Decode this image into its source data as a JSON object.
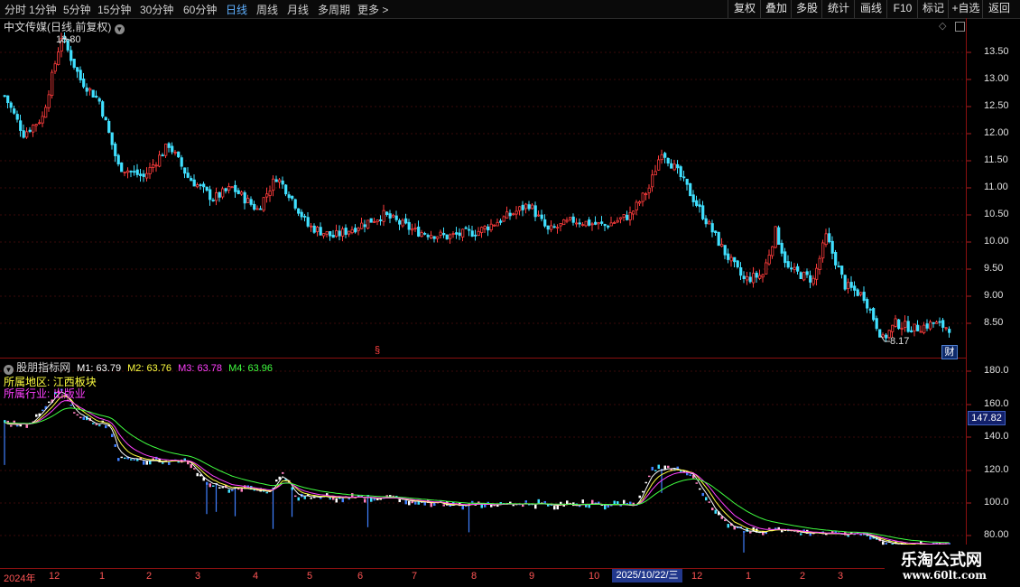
{
  "toolbar": {
    "periods": [
      {
        "label": "分时",
        "x": 5
      },
      {
        "label": "1分钟",
        "x": 32
      },
      {
        "label": "5分钟",
        "x": 70
      },
      {
        "label": "15分钟",
        "x": 108
      },
      {
        "label": "30分钟",
        "x": 155
      },
      {
        "label": "60分钟",
        "x": 203
      },
      {
        "label": "日线",
        "x": 250,
        "active": true
      },
      {
        "label": "周线",
        "x": 284
      },
      {
        "label": "月线",
        "x": 318
      },
      {
        "label": "多周期",
        "x": 352
      },
      {
        "label": "更多 >",
        "x": 396
      }
    ],
    "tools": [
      {
        "label": "复权",
        "x": 806,
        "w": 36
      },
      {
        "label": "叠加",
        "x": 842,
        "w": 34
      },
      {
        "label": "多股",
        "x": 876,
        "w": 34
      },
      {
        "label": "统计",
        "x": 910,
        "w": 36
      },
      {
        "label": "画线",
        "x": 946,
        "w": 36
      },
      {
        "label": "F10",
        "x": 982,
        "w": 34
      },
      {
        "label": "标记",
        "x": 1016,
        "w": 34
      },
      {
        "label": "+自选",
        "x": 1050,
        "w": 38
      },
      {
        "label": "返回",
        "x": 1088,
        "w": 36
      }
    ]
  },
  "main_chart": {
    "title": "中文传媒(日线,前复权)",
    "high_label": "13.80",
    "low_label": "8.17",
    "cai_badge": "财",
    "y_ticks": [
      "13.50",
      "13.00",
      "12.50",
      "12.00",
      "11.50",
      "11.00",
      "10.50",
      "10.00",
      "9.50",
      "9.00",
      "8.50"
    ]
  },
  "indicator": {
    "name": "股朋指标网",
    "m1": "M1: 63.79",
    "m2": "M2: 63.76",
    "m3": "M3: 63.78",
    "m4": "M4: 63.96",
    "region_label": "所属地区:",
    "region_value": "江西板块",
    "industry_label": "所属行业:",
    "industry_value": "出版业",
    "y_ticks": [
      "180.0",
      "160.0",
      "140.0",
      "120.0",
      "100.0",
      "80.00"
    ],
    "price_tag": "147.82"
  },
  "time_axis": {
    "labels": [
      "2024年",
      "12",
      "1",
      "2",
      "3",
      "4",
      "5",
      "6",
      "7",
      "8",
      "9",
      "10",
      "12",
      "1",
      "2",
      "3"
    ],
    "cursor_date": "2025/10/22/三"
  },
  "watermark": {
    "title": "乐淘公式网",
    "url": "www.60lt.com"
  },
  "chart_data": {
    "type": "candlestick",
    "price_range": [
      8.0,
      13.9
    ],
    "close_anchors": [
      [
        0,
        12.7
      ],
      [
        6,
        12.0
      ],
      [
        12,
        12.3
      ],
      [
        18,
        13.8
      ],
      [
        24,
        13.0
      ],
      [
        30,
        12.6
      ],
      [
        36,
        11.4
      ],
      [
        44,
        11.2
      ],
      [
        52,
        11.8
      ],
      [
        58,
        11.2
      ],
      [
        66,
        10.8
      ],
      [
        72,
        11.0
      ],
      [
        80,
        10.6
      ],
      [
        86,
        11.2
      ],
      [
        90,
        10.9
      ],
      [
        96,
        10.3
      ],
      [
        104,
        10.1
      ],
      [
        112,
        10.3
      ],
      [
        120,
        10.5
      ],
      [
        130,
        10.2
      ],
      [
        140,
        10.1
      ],
      [
        150,
        10.2
      ],
      [
        160,
        10.5
      ],
      [
        166,
        10.7
      ],
      [
        172,
        10.2
      ],
      [
        180,
        10.4
      ],
      [
        190,
        10.3
      ],
      [
        198,
        10.5
      ],
      [
        204,
        11.0
      ],
      [
        208,
        11.7
      ],
      [
        214,
        11.2
      ],
      [
        220,
        10.6
      ],
      [
        228,
        9.8
      ],
      [
        234,
        9.3
      ],
      [
        240,
        9.4
      ],
      [
        244,
        10.2
      ],
      [
        248,
        9.5
      ],
      [
        256,
        9.3
      ],
      [
        260,
        10.1
      ],
      [
        266,
        9.2
      ],
      [
        272,
        9.0
      ],
      [
        278,
        8.2
      ],
      [
        282,
        8.5
      ],
      [
        288,
        8.4
      ],
      [
        294,
        8.5
      ],
      [
        300,
        8.4
      ]
    ],
    "indicator_range": [
      75,
      185
    ],
    "indicator_anchors": [
      [
        0,
        148
      ],
      [
        8,
        148
      ],
      [
        18,
        170
      ],
      [
        22,
        155
      ],
      [
        28,
        148
      ],
      [
        33,
        148
      ],
      [
        36,
        128
      ],
      [
        50,
        125
      ],
      [
        58,
        125
      ],
      [
        64,
        112
      ],
      [
        70,
        109
      ],
      [
        76,
        108
      ],
      [
        84,
        107
      ],
      [
        88,
        118
      ],
      [
        92,
        104
      ],
      [
        110,
        103
      ],
      [
        120,
        103
      ],
      [
        130,
        101
      ],
      [
        140,
        99
      ],
      [
        150,
        99
      ],
      [
        160,
        99
      ],
      [
        170,
        99
      ],
      [
        190,
        99
      ],
      [
        200,
        99
      ],
      [
        205,
        120
      ],
      [
        212,
        121
      ],
      [
        218,
        116
      ],
      [
        224,
        96
      ],
      [
        230,
        85
      ],
      [
        238,
        82
      ],
      [
        246,
        84
      ],
      [
        252,
        82
      ],
      [
        262,
        81
      ],
      [
        272,
        81
      ],
      [
        276,
        78
      ],
      [
        280,
        75
      ]
    ]
  },
  "colors": {
    "up": "#ff3c3c",
    "down": "#40e0ff",
    "m1": "#ffffff",
    "m2": "#ffff40",
    "m3": "#ff40ff",
    "m4": "#40ff40",
    "grid": "#3a0a0a",
    "divider": "#8a1010"
  }
}
